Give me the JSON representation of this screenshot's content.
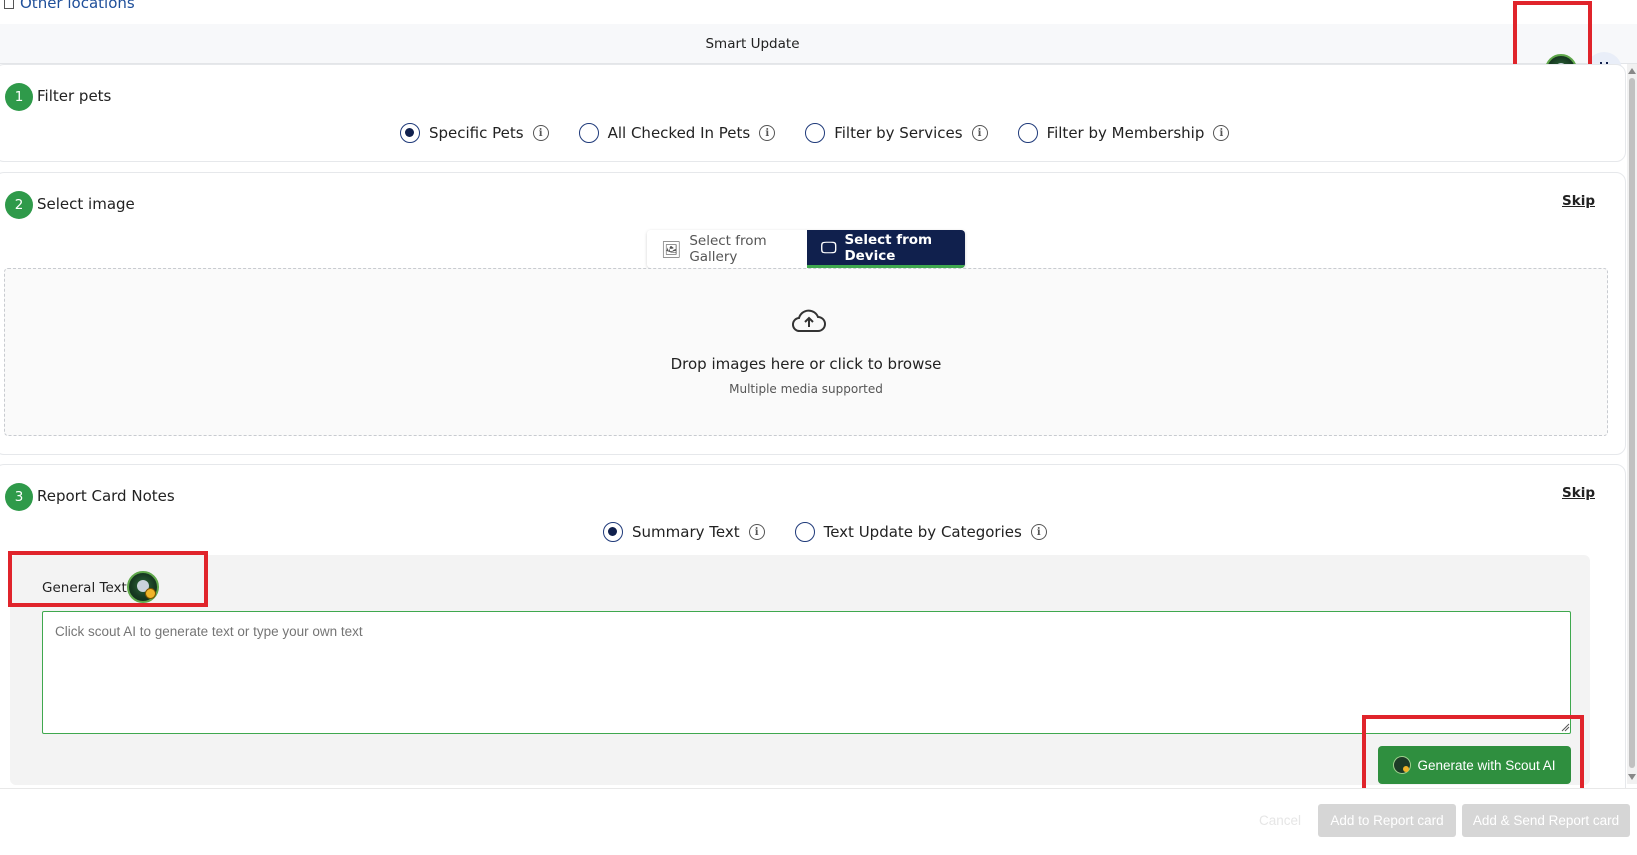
{
  "top": {
    "location_label": "Other locations"
  },
  "header": {
    "title": "Smart Update"
  },
  "step1": {
    "number": "1",
    "title": "Filter pets",
    "options": [
      {
        "label": "Specific Pets",
        "checked": true
      },
      {
        "label": "All Checked In Pets",
        "checked": false
      },
      {
        "label": "Filter by Services",
        "checked": false
      },
      {
        "label": "Filter by Membership",
        "checked": false
      }
    ]
  },
  "step2": {
    "number": "2",
    "title": "Select image",
    "skip": "Skip",
    "tabs": [
      {
        "label": "Select from Gallery",
        "active": false
      },
      {
        "label": "Select from Device",
        "active": true
      }
    ],
    "dropzone": {
      "text": "Drop images here or click to browse",
      "subtext": "Multiple media supported"
    }
  },
  "step3": {
    "number": "3",
    "title": "Report Card Notes",
    "skip": "Skip",
    "options": [
      {
        "label": "Summary Text",
        "checked": true
      },
      {
        "label": "Text Update by Categories",
        "checked": false
      }
    ],
    "general_label": "General Text",
    "textarea_placeholder": "Click scout AI to generate text or type your own text",
    "generate_button": "Generate with Scout AI"
  },
  "footer": {
    "cancel": "Cancel",
    "add": "Add to Report card",
    "send": "Add & Send Report card"
  },
  "colors": {
    "accent_green": "#2f9a4a",
    "navy": "#10204d",
    "highlight_red": "#e0242b"
  }
}
